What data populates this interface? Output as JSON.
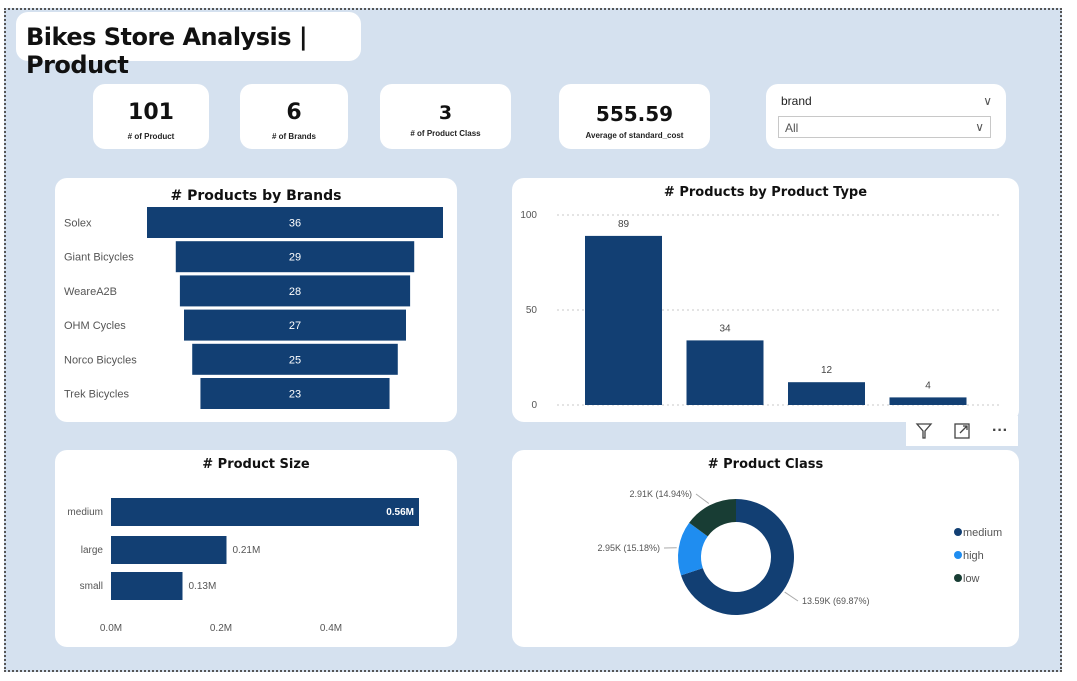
{
  "title": "Bikes Store Analysis | Product",
  "kpis": [
    {
      "value": "101",
      "label": "# of Product"
    },
    {
      "value": "6",
      "label": "# of Brands"
    },
    {
      "value": "3",
      "label": "# of Product Class"
    },
    {
      "value": "555.59",
      "label": "Average of standard_cost"
    }
  ],
  "slicer": {
    "header": "brand",
    "value": "All"
  },
  "toolbar": {
    "filter_icon": "filter-icon",
    "focus_icon": "focus-mode-icon",
    "more_icon": "more-options-icon",
    "more_label": "···"
  },
  "chart_data": [
    {
      "type": "bar",
      "title": "# Products by Brands",
      "categories": [
        "Solex",
        "Giant Bicycles",
        "WeareA2B",
        "OHM Cycles",
        "Norco Bicycles",
        "Trek Bicycles"
      ],
      "values": [
        36,
        29,
        28,
        27,
        25,
        23
      ],
      "color": "#123f73"
    },
    {
      "type": "bar",
      "title": "# Products by Product Type",
      "categories": [
        "",
        "",
        "",
        ""
      ],
      "values": [
        89,
        34,
        12,
        4
      ],
      "data_labels": [
        "89",
        "34",
        "12",
        "4"
      ],
      "yticks": [
        "0",
        "50",
        "100"
      ],
      "ylim": [
        0,
        100
      ],
      "grid": true,
      "color": "#123f73"
    },
    {
      "type": "bar",
      "title": "# Product Size",
      "categories": [
        "medium",
        "large",
        "small"
      ],
      "values": [
        0.56,
        0.21,
        0.13
      ],
      "data_labels": [
        "0.56M",
        "0.21M",
        "0.13M"
      ],
      "xticks": [
        "0.0M",
        "0.2M",
        "0.4M"
      ],
      "xlim": [
        0,
        0.6
      ],
      "color": "#123f73"
    },
    {
      "type": "pie",
      "title": "# Product Class",
      "series": [
        {
          "name": "medium",
          "value": 13.59,
          "label": "13.59K (69.87%)",
          "color": "#123f73"
        },
        {
          "name": "high",
          "value": 2.95,
          "label": "2.95K (15.18%)",
          "color": "#1f8df0"
        },
        {
          "name": "low",
          "value": 2.91,
          "label": "2.91K (14.94%)",
          "color": "#183d34"
        }
      ],
      "legend": "right"
    }
  ]
}
